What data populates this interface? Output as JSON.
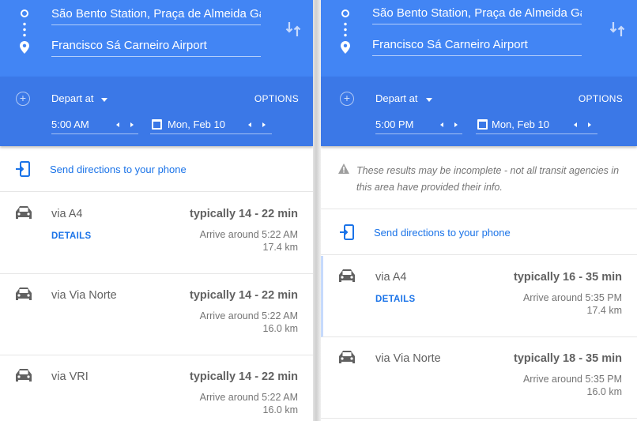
{
  "colors": {
    "header_blue": "#4285f4",
    "depart_blue": "#3b78e7",
    "link_blue": "#1a73e8",
    "text_gray": "#616161"
  },
  "icons": {
    "origin": "origin-circle-icon",
    "destination": "pin-icon",
    "swap": "swap-arrows-icon",
    "add": "add-circle-icon",
    "calendar": "calendar-icon",
    "phone": "send-to-phone-icon",
    "car": "car-icon",
    "warning": "warning-icon"
  },
  "left": {
    "origin": "São Bento Station, Praça de Almeida Ga",
    "destination": "Francisco Sá Carneiro Airport",
    "depart_label": "Depart at",
    "options": "OPTIONS",
    "time": "5:00 AM",
    "date": "Mon, Feb 10",
    "send": "Send directions to your phone",
    "routes": [
      {
        "via": "via A4",
        "details": "DETAILS",
        "duration": "typically 14 - 22 min",
        "arrive": "Arrive around 5:22 AM",
        "distance": "17.4 km"
      },
      {
        "via": "via Via Norte",
        "duration": "typically 14 - 22 min",
        "arrive": "Arrive around 5:22 AM",
        "distance": "16.0 km"
      },
      {
        "via": "via VRI",
        "duration": "typically 14 - 22 min",
        "arrive": "Arrive around 5:22 AM",
        "distance": "16.0 km"
      }
    ]
  },
  "right": {
    "origin": "São Bento Station, Praça de Almeida Ga",
    "destination": "Francisco Sá Carneiro Airport",
    "depart_label": "Depart at",
    "options": "OPTIONS",
    "time": "5:00 PM",
    "date": "Mon, Feb 10",
    "warning": "These results may be incomplete - not all transit agencies in this area have provided their info.",
    "send": "Send directions to your phone",
    "routes": [
      {
        "via": "via A4",
        "details": "DETAILS",
        "duration": "typically 16 - 35 min",
        "arrive": "Arrive around 5:35 PM",
        "distance": "17.4 km"
      },
      {
        "via": "via Via Norte",
        "duration": "typically 18 - 35 min",
        "arrive": "Arrive around 5:35 PM",
        "distance": "16.0 km"
      }
    ]
  }
}
